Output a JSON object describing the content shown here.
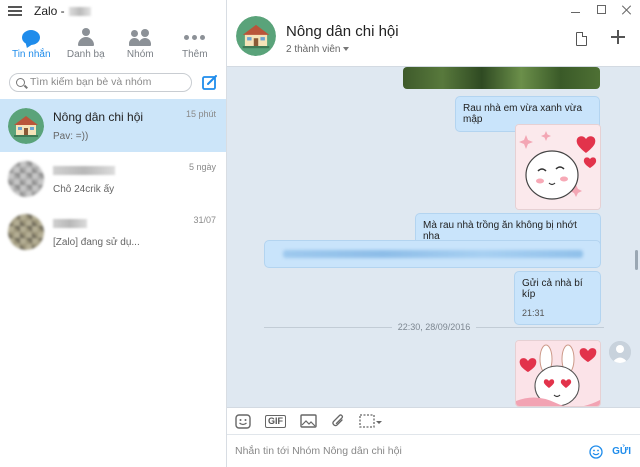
{
  "app": {
    "title": "Zalo -"
  },
  "nav": {
    "items": [
      {
        "label": "Tin nhắn",
        "icon": "chat-bubble-icon",
        "active": true
      },
      {
        "label": "Danh bạ",
        "icon": "contact-icon"
      },
      {
        "label": "Nhóm",
        "icon": "group-icon"
      },
      {
        "label": "Thêm",
        "icon": "more-icon"
      }
    ]
  },
  "search": {
    "placeholder": "Tìm kiếm bạn bè và nhóm"
  },
  "conversations": [
    {
      "name": "Nông dân chi hội",
      "preview": "Pav: =))",
      "time": "15 phút",
      "active": true
    },
    {
      "name": "",
      "preview": "Chỗ 24crik ấy",
      "time": "5 ngày"
    },
    {
      "name": "",
      "preview": "[Zalo]      đang sử dụ...",
      "time": "31/07"
    }
  ],
  "chat": {
    "title": "Nông dân chi hội",
    "members": "2 thành viên",
    "messages": [
      {
        "text": "Rau nhà em vừa xanh vừa mập"
      },
      {
        "text": "Mà rau nhà trồng ăn không bị nhớt nha"
      },
      {
        "text": "Gửi cả nhà bí kíp",
        "time": "21:31"
      }
    ],
    "date_separator": "22:30, 28/09/2016"
  },
  "toolbar": {
    "gif_label": "GIF"
  },
  "composer": {
    "placeholder": "Nhắn tin tới Nhóm Nông dân chi hội",
    "send_label": "GỬI"
  },
  "colors": {
    "accent": "#1f8ceb",
    "bubble": "#c9e4fb",
    "chat_bg": "#dfe8f1",
    "active_row": "#cce5f9"
  }
}
